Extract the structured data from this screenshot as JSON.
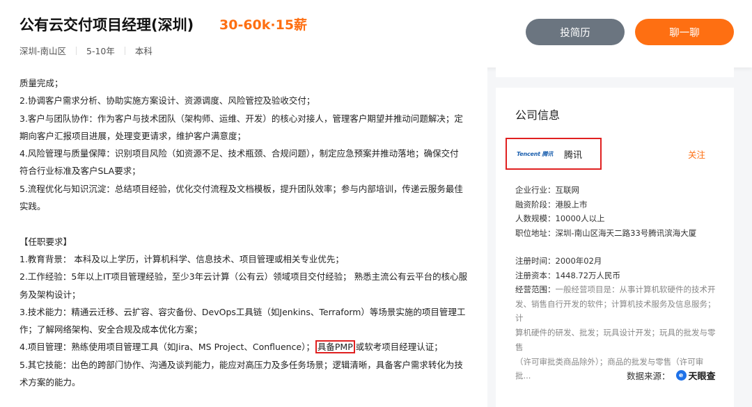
{
  "header": {
    "title": "公有云交付项目经理(深圳)",
    "salary": "30-60k·15薪",
    "location": "深圳-南山区",
    "experience": "5-10年",
    "education": "本科",
    "resume_button": "投简历",
    "chat_button": "聊一聊"
  },
  "jd": {
    "line_01": "质量完成；",
    "line_02": "2.协调客户需求分析、协助实施方案设计、资源调度、风险管控及验收交付；",
    "line_03": "3.客户与团队协作：作为客户与技术团队（架构师、运维、开发）的核心对接人，管理客户期望并推动问题解决；定",
    "line_04": "期向客户汇报项目进展，处理变更请求，维护客户满意度；",
    "line_05": "4.风险管理与质量保障：识别项目风险（如资源不足、技术瓶颈、合规问题），制定应急预案并推动落地；确保交付",
    "line_06": "符合行业标准及客户SLA要求；",
    "line_07": "5.流程优化与知识沉淀：总结项目经验，优化交付流程及文档模板，提升团队效率；参与内部培训，传递云服务最佳",
    "line_08": "实践。",
    "req_title": "【任职要求】",
    "line_10": "1.教育背景： 本科及以上学历，计算机科学、信息技术、项目管理或相关专业优先；",
    "line_11": "2.工作经验：5年以上IT项目管理经验，至少3年云计算（公有云）领域项目交付经验； 熟悉主流公有云平台的核心服",
    "line_12": "务及架构设计；",
    "line_13": "3.技术能力：精通云迁移、云扩容、容灾备份、DevOps工具链（如Jenkins、Terraform）等场景实施的项目管理工",
    "line_14": "作；了解网络架构、安全合规及成本优化方案；",
    "line_15a": "4.项目管理：熟练使用项目管理工具（如Jira、MS Project、Confluence）；",
    "line_15b": "具备PMP",
    "line_15c": "或软考项目经理认证；",
    "line_16": "5.其它技能：出色的跨部门协作、沟通及谈判能力，能应对高压力及多任务场景；逻辑清晰，具备客户需求转化为技",
    "line_17": "术方案的能力。"
  },
  "company": {
    "heading": "公司信息",
    "logo_text": "Tencent 腾讯",
    "name": "腾讯",
    "follow": "关注",
    "industry_label": "企业行业：",
    "industry": "互联网",
    "funding_label": "融资阶段：",
    "funding": "港股上市",
    "size_label": "人数规模：",
    "size": "10000人以上",
    "address_label": "职位地址：",
    "address": "深圳-南山区海天二路33号腾讯滨海大厦",
    "reg_time_label": "注册时间：",
    "reg_time": "2000年02月",
    "capital_label": "注册资本：",
    "capital": "1448.72万人民币",
    "scope_label": "经营范围：",
    "scope_1": "一般经营项目是：从事计算机软硬件的技术开",
    "scope_2": "发、销售自行开发的软件；计算机技术服务及信息服务；计",
    "scope_3": "算机硬件的研发、批发；玩具设计开发；玩具的批发与零售",
    "scope_4": "（许可审批类商品除外）；商品的批发与零售（许可审批...",
    "source_label": "数据来源：",
    "source_name": "天眼查"
  }
}
